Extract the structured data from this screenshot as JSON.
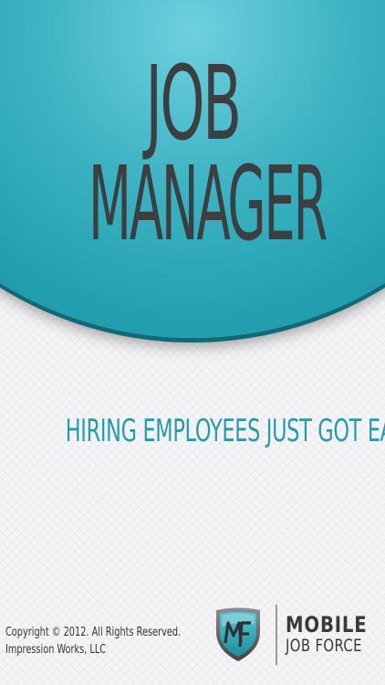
{
  "hero": {
    "title_line_1": "JOB",
    "title_line_2": "MANAGER"
  },
  "tagline": "HIRING EMPLOYEES JUST GOT EASIER",
  "footer": {
    "copyright_line_1": "Copyright © 2012. All Rights Reserved.",
    "copyright_line_2": "Impression Works, LLC",
    "brand_line_1": "MOBILE",
    "brand_line_2": "JOB FORCE"
  },
  "colors": {
    "accent": "#23a0b0",
    "title_text": "#3c3f42",
    "tagline_text": "#2a9aaa",
    "background": "#f4f4f6"
  },
  "icons": {
    "brand_logo": "mobile-job-force-shield-icon"
  }
}
